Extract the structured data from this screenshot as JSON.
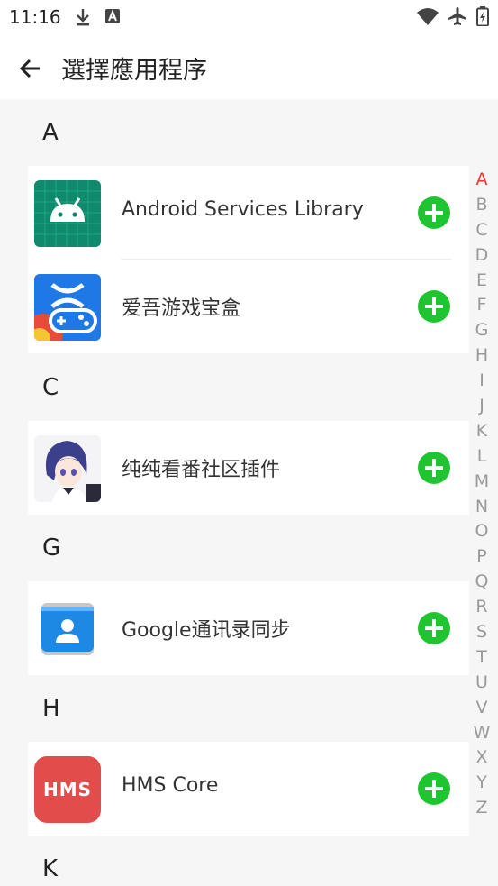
{
  "status": {
    "time": "11:16"
  },
  "header": {
    "title": "選擇應用程序"
  },
  "sections": [
    {
      "letter": "A",
      "apps": [
        {
          "name": "Android Services Library",
          "icon": "android-icon"
        },
        {
          "name": "爱吾游戏宝盒",
          "icon": "game-box-icon"
        }
      ]
    },
    {
      "letter": "C",
      "apps": [
        {
          "name": "纯纯看番社区插件",
          "icon": "anime-avatar-icon"
        }
      ]
    },
    {
      "letter": "G",
      "apps": [
        {
          "name": "Google通讯录同步",
          "icon": "contacts-icon"
        }
      ]
    },
    {
      "letter": "H",
      "apps": [
        {
          "name": "HMS Core",
          "icon": "hms-icon",
          "icon_text": "HMS"
        }
      ]
    },
    {
      "letter": "K",
      "apps": []
    }
  ],
  "index": {
    "letters": [
      "A",
      "B",
      "C",
      "D",
      "E",
      "F",
      "G",
      "H",
      "I",
      "J",
      "K",
      "L",
      "M",
      "N",
      "O",
      "P",
      "Q",
      "R",
      "S",
      "T",
      "U",
      "V",
      "W",
      "X",
      "Y",
      "Z"
    ],
    "active": "A",
    "active_color": "#e53935"
  },
  "colors": {
    "accent_add": "#1fc431"
  }
}
